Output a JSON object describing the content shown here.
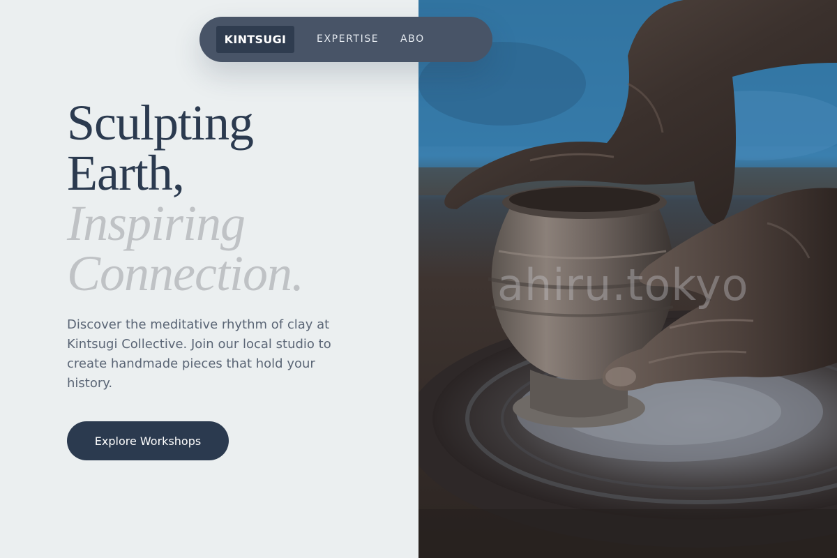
{
  "nav": {
    "brand": "KINTSUGI",
    "links": [
      "EXPERTISE",
      "ABO"
    ]
  },
  "hero": {
    "title_line1": "Sculpting",
    "title_line2": "Earth,",
    "title_line3": "Inspiring",
    "title_line4": "Connection.",
    "description": "Discover the meditative rhythm of clay at Kintsugi Collective. Join our local studio to create handmade pieces that hold your history.",
    "cta_label": "Explore Workshops"
  },
  "image": {
    "subject": "hands-shaping-clay-pot-on-pottery-wheel",
    "watermark": "ahiru.tokyo"
  },
  "colors": {
    "background": "#ebeff0",
    "nav_pill": "#485467",
    "brand_chip": "#2f3c4f",
    "heading_dark": "#2b3a4f",
    "heading_light": "#bfc2c5",
    "body_text": "#5a6575",
    "cta_bg": "#2b3a4f"
  }
}
